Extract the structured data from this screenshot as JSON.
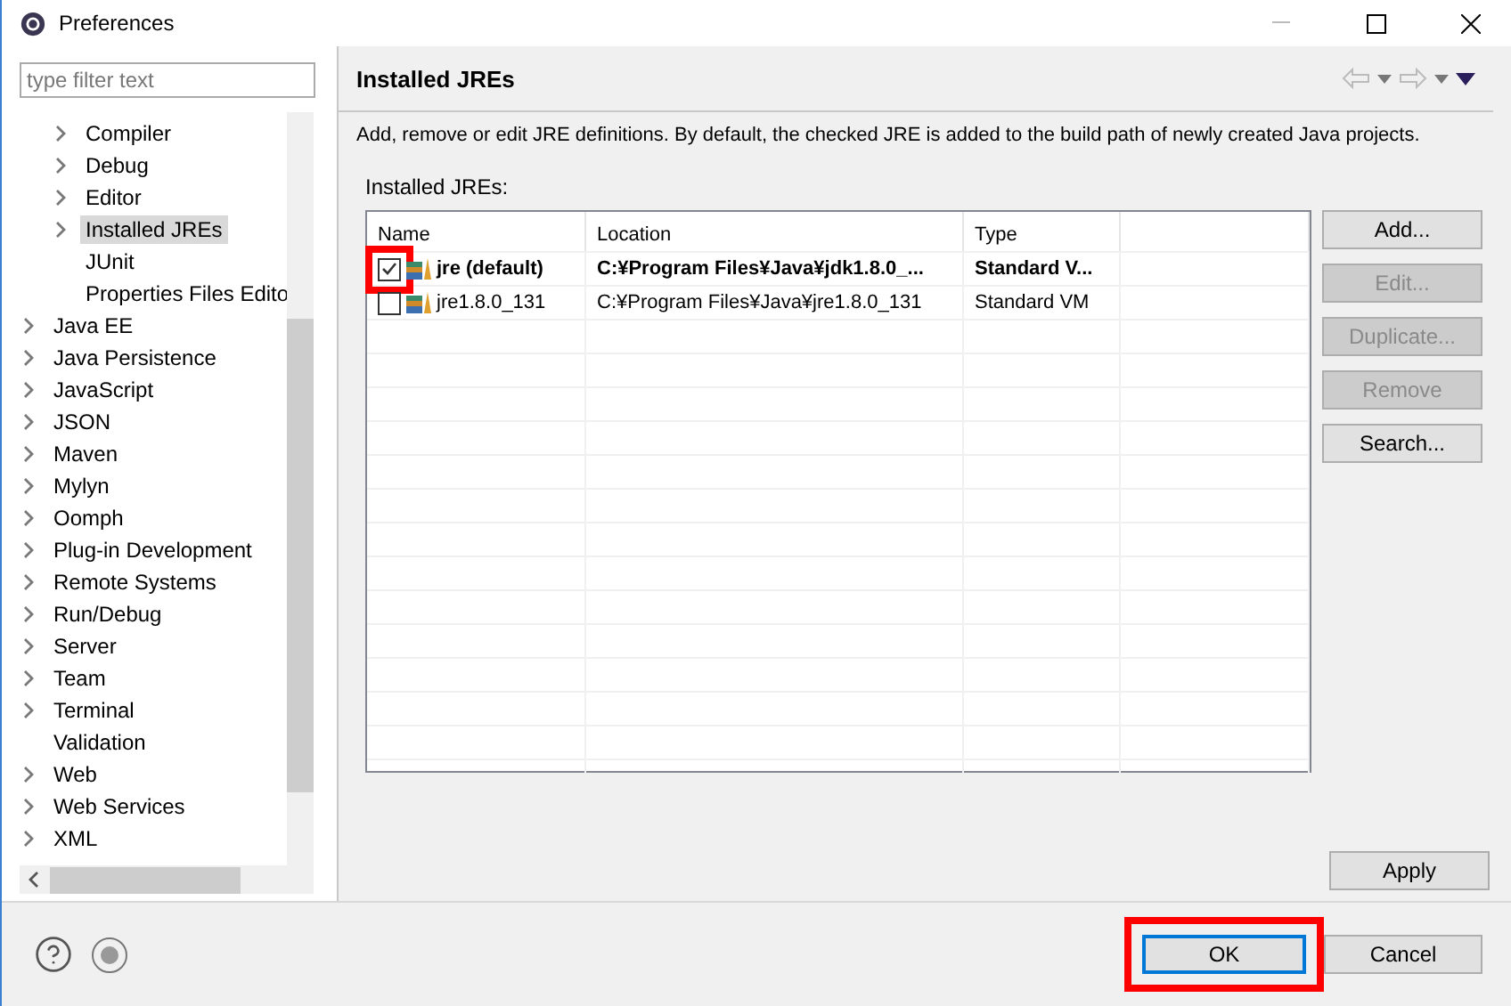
{
  "window": {
    "title": "Preferences"
  },
  "filter": {
    "placeholder": "type filter text"
  },
  "tree": {
    "items": [
      {
        "children": [
          {
            "label": "Compiler",
            "expandable": true,
            "selected": false
          },
          {
            "label": "Debug",
            "expandable": true,
            "selected": false
          },
          {
            "label": "Editor",
            "expandable": true,
            "selected": false
          },
          {
            "label": "Installed JREs",
            "expandable": true,
            "selected": true
          },
          {
            "label": "JUnit",
            "expandable": false,
            "selected": false
          },
          {
            "label": "Properties Files Edito",
            "expandable": false,
            "selected": false
          }
        ]
      },
      {
        "label": "Java EE",
        "expandable": true,
        "selected": false
      },
      {
        "label": "Java Persistence",
        "expandable": true,
        "selected": false
      },
      {
        "label": "JavaScript",
        "expandable": true,
        "selected": false
      },
      {
        "label": "JSON",
        "expandable": true,
        "selected": false
      },
      {
        "label": "Maven",
        "expandable": true,
        "selected": false
      },
      {
        "label": "Mylyn",
        "expandable": true,
        "selected": false
      },
      {
        "label": "Oomph",
        "expandable": true,
        "selected": false
      },
      {
        "label": "Plug-in Development",
        "expandable": true,
        "selected": false
      },
      {
        "label": "Remote Systems",
        "expandable": true,
        "selected": false
      },
      {
        "label": "Run/Debug",
        "expandable": true,
        "selected": false
      },
      {
        "label": "Server",
        "expandable": true,
        "selected": false
      },
      {
        "label": "Team",
        "expandable": true,
        "selected": false
      },
      {
        "label": "Terminal",
        "expandable": true,
        "selected": false
      },
      {
        "label": "Validation",
        "expandable": false,
        "selected": false
      },
      {
        "label": "Web",
        "expandable": true,
        "selected": false
      },
      {
        "label": "Web Services",
        "expandable": true,
        "selected": false
      },
      {
        "label": "XML",
        "expandable": true,
        "selected": false
      }
    ]
  },
  "page": {
    "title": "Installed JREs",
    "description": "Add, remove or edit JRE definitions. By default, the checked JRE is added to the build path of newly created Java projects.",
    "table_label": "Installed JREs:"
  },
  "table": {
    "columns": [
      "Name",
      "Location",
      "Type"
    ],
    "rows": [
      {
        "name": "jre (default)",
        "location": "C:¥Program Files¥Java¥jdk1.8.0_...",
        "type": "Standard V...",
        "checked": true,
        "default": true,
        "highlighted": true
      },
      {
        "name": "jre1.8.0_131",
        "location": "C:¥Program Files¥Java¥jre1.8.0_131",
        "type": "Standard VM",
        "checked": false,
        "default": false,
        "highlighted": false
      }
    ]
  },
  "side_buttons": [
    {
      "label": "Add...",
      "disabled": false
    },
    {
      "label": "Edit...",
      "disabled": true
    },
    {
      "label": "Duplicate...",
      "disabled": true
    },
    {
      "label": "Remove",
      "disabled": true
    },
    {
      "label": "Search...",
      "disabled": false
    }
  ],
  "apply_button": {
    "label": "Apply"
  },
  "footer_buttons": [
    {
      "label": "OK",
      "default": true,
      "highlighted": true
    },
    {
      "label": "Cancel",
      "default": false,
      "highlighted": false
    }
  ]
}
